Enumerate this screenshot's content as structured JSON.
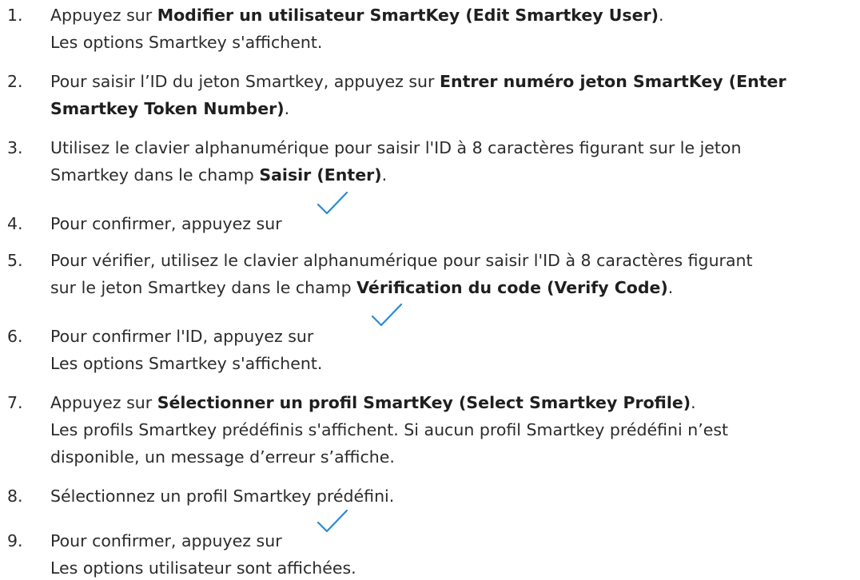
{
  "steps": [
    {
      "number": "1.",
      "lines": [
        {
          "parts": [
            {
              "text": "Appuyez sur ",
              "bold": false
            },
            {
              "text": "Modifier un utilisateur SmartKey (Edit Smartkey User)",
              "bold": true
            },
            {
              "text": ".",
              "bold": false
            }
          ]
        },
        {
          "parts": [
            {
              "text": "Les options Smartkey s'affichent.",
              "bold": false
            }
          ]
        }
      ]
    },
    {
      "number": "2.",
      "lines": [
        {
          "parts": [
            {
              "text": "Pour saisir l’ID du jeton Smartkey, appuyez sur ",
              "bold": false
            },
            {
              "text": "Entrer numéro jeton SmartKey (Enter",
              "bold": true
            }
          ]
        },
        {
          "parts": [
            {
              "text": "Smartkey Token Number)",
              "bold": true
            },
            {
              "text": ".",
              "bold": false
            }
          ]
        }
      ]
    },
    {
      "number": "3.",
      "lines": [
        {
          "parts": [
            {
              "text": "Utilisez le clavier alphanumérique pour saisir l'ID à 8 caractères figurant sur le jeton",
              "bold": false
            }
          ]
        },
        {
          "parts": [
            {
              "text": "Smartkey dans le champ ",
              "bold": false
            },
            {
              "text": "Saisir (Enter)",
              "bold": true
            },
            {
              "text": ".",
              "bold": false
            }
          ]
        }
      ]
    },
    {
      "number": "4.",
      "lines": [
        {
          "parts": [
            {
              "text": "Pour confirmer, appuyez sur",
              "bold": false
            }
          ]
        }
      ]
    },
    {
      "number": "5.",
      "lines": [
        {
          "parts": [
            {
              "text": "Pour vérifier, utilisez le clavier alphanumérique pour saisir l'ID à 8 caractères figurant",
              "bold": false
            }
          ]
        },
        {
          "parts": [
            {
              "text": "sur le jeton Smartkey dans le champ ",
              "bold": false
            },
            {
              "text": "Vérification du code (Verify Code)",
              "bold": true
            },
            {
              "text": ".",
              "bold": false
            }
          ]
        }
      ]
    },
    {
      "number": "6.",
      "lines": [
        {
          "parts": [
            {
              "text": "Pour confirmer l'ID, appuyez sur",
              "bold": false
            }
          ]
        },
        {
          "parts": [
            {
              "text": "Les options Smartkey s'affichent.",
              "bold": false
            }
          ]
        }
      ]
    },
    {
      "number": "7.",
      "lines": [
        {
          "parts": [
            {
              "text": "Appuyez sur ",
              "bold": false
            },
            {
              "text": "Sélectionner un profil SmartKey (Select Smartkey Profile)",
              "bold": true
            },
            {
              "text": ".",
              "bold": false
            }
          ]
        },
        {
          "parts": [
            {
              "text": "Les profils Smartkey prédéfinis s'affichent. Si aucun profil Smartkey prédéfini n’est",
              "bold": false
            }
          ]
        },
        {
          "parts": [
            {
              "text": "disponible, un message d’erreur s’affiche.",
              "bold": false
            }
          ]
        }
      ]
    },
    {
      "number": "8.",
      "lines": [
        {
          "parts": [
            {
              "text": "Sélectionnez un profil Smartkey prédéfini.",
              "bold": false
            }
          ]
        }
      ]
    },
    {
      "number": "9.",
      "lines": [
        {
          "parts": [
            {
              "text": "Pour confirmer, appuyez sur",
              "bold": false
            }
          ]
        },
        {
          "parts": [
            {
              "text": "Les options utilisateur sont affichées.",
              "bold": false
            }
          ]
        }
      ]
    }
  ],
  "icons": {
    "confirm_check": "checkmark-icon",
    "check_color": "#2a8ad4"
  }
}
